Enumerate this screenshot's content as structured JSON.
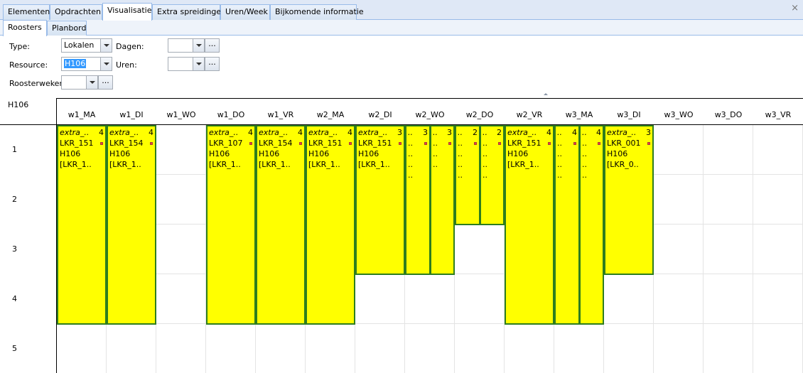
{
  "tabs": [
    {
      "label": "Elementen"
    },
    {
      "label": "Opdrachten"
    },
    {
      "label": "Visualisatie"
    },
    {
      "label": "Extra spreidingen"
    },
    {
      "label": "Uren/Week"
    },
    {
      "label": "Bijkomende informatie"
    }
  ],
  "subtabs": [
    {
      "label": "Roosters"
    },
    {
      "label": "Planbord"
    }
  ],
  "filters": {
    "type_label": "Type:",
    "type_value": "Lokalen",
    "resource_label": "Resource:",
    "resource_value": "H106",
    "dagen_label": "Dagen:",
    "dagen_value": "",
    "uren_label": "Uren:",
    "uren_value": "",
    "roosterweken_label": "Roosterweken",
    "roosterweken_value": "",
    "ellipsis": "..."
  },
  "grid": {
    "resource": "H106",
    "columns": [
      "w1_MA",
      "w1_DI",
      "w1_WO",
      "w1_DO",
      "w1_VR",
      "w2_MA",
      "w2_DI",
      "w2_WO",
      "w2_DO",
      "w2_VR",
      "w3_MA",
      "w3_DI",
      "w3_WO",
      "w3_DO",
      "w3_VR"
    ],
    "rows": [
      "1",
      "2",
      "3",
      "4",
      "5"
    ]
  },
  "blocks": [
    {
      "col": 0,
      "sub": 0,
      "of": 1,
      "span": 4,
      "lines": [
        "extra_..",
        "LKR_151",
        "H106",
        "[LKR_1.."
      ],
      "num": "4"
    },
    {
      "col": 1,
      "sub": 0,
      "of": 1,
      "span": 4,
      "lines": [
        "extra_..",
        "LKR_154",
        "H106",
        "[LKR_1.."
      ],
      "num": "4"
    },
    {
      "col": 3,
      "sub": 0,
      "of": 1,
      "span": 4,
      "lines": [
        "extra_..",
        "LKR_107",
        "H106",
        "[LKR_1.."
      ],
      "num": "4"
    },
    {
      "col": 4,
      "sub": 0,
      "of": 1,
      "span": 4,
      "lines": [
        "extra_..",
        "LKR_154",
        "H106",
        "[LKR_1.."
      ],
      "num": "4"
    },
    {
      "col": 5,
      "sub": 0,
      "of": 1,
      "span": 4,
      "lines": [
        "extra_..",
        "LKR_151",
        "H106",
        "[LKR_1.."
      ],
      "num": "4"
    },
    {
      "col": 6,
      "sub": 0,
      "of": 1,
      "span": 3,
      "lines": [
        "extra_..",
        "LKR_151",
        "H106",
        "[LKR_1.."
      ],
      "num": "3"
    },
    {
      "col": 7,
      "sub": 0,
      "of": 2,
      "span": 3,
      "lines": [
        "..",
        "..",
        "..",
        "..",
        ".."
      ],
      "num": "3"
    },
    {
      "col": 7,
      "sub": 1,
      "of": 2,
      "span": 3,
      "lines": [
        "..",
        "..",
        "..",
        ".."
      ],
      "num": "3"
    },
    {
      "col": 8,
      "sub": 0,
      "of": 2,
      "span": 2,
      "lines": [
        "..",
        "..",
        "..",
        "..",
        ".."
      ],
      "num": "2"
    },
    {
      "col": 8,
      "sub": 1,
      "of": 2,
      "span": 2,
      "lines": [
        "..",
        "..",
        "..",
        "..",
        ".."
      ],
      "num": "2"
    },
    {
      "col": 9,
      "sub": 0,
      "of": 1,
      "span": 4,
      "lines": [
        "extra_..",
        "LKR_151",
        "H106",
        "[LKR_1.."
      ],
      "num": "4"
    },
    {
      "col": 10,
      "sub": 0,
      "of": 2,
      "span": 4,
      "lines": [
        "..",
        "..",
        "..",
        "..",
        ".."
      ],
      "num": "4"
    },
    {
      "col": 10,
      "sub": 1,
      "of": 2,
      "span": 4,
      "lines": [
        "..",
        "..",
        "..",
        "..",
        ".."
      ],
      "num": "4"
    },
    {
      "col": 11,
      "sub": 0,
      "of": 1,
      "span": 3,
      "lines": [
        "extra_..",
        "LKR_001",
        "H106",
        "[LKR_0.."
      ],
      "num": "3"
    }
  ],
  "colors": {
    "block_fill": "#ffff00",
    "block_border": "#2e7d1e",
    "tab_border": "#99bbe8",
    "dot": "#ff3a3a"
  }
}
